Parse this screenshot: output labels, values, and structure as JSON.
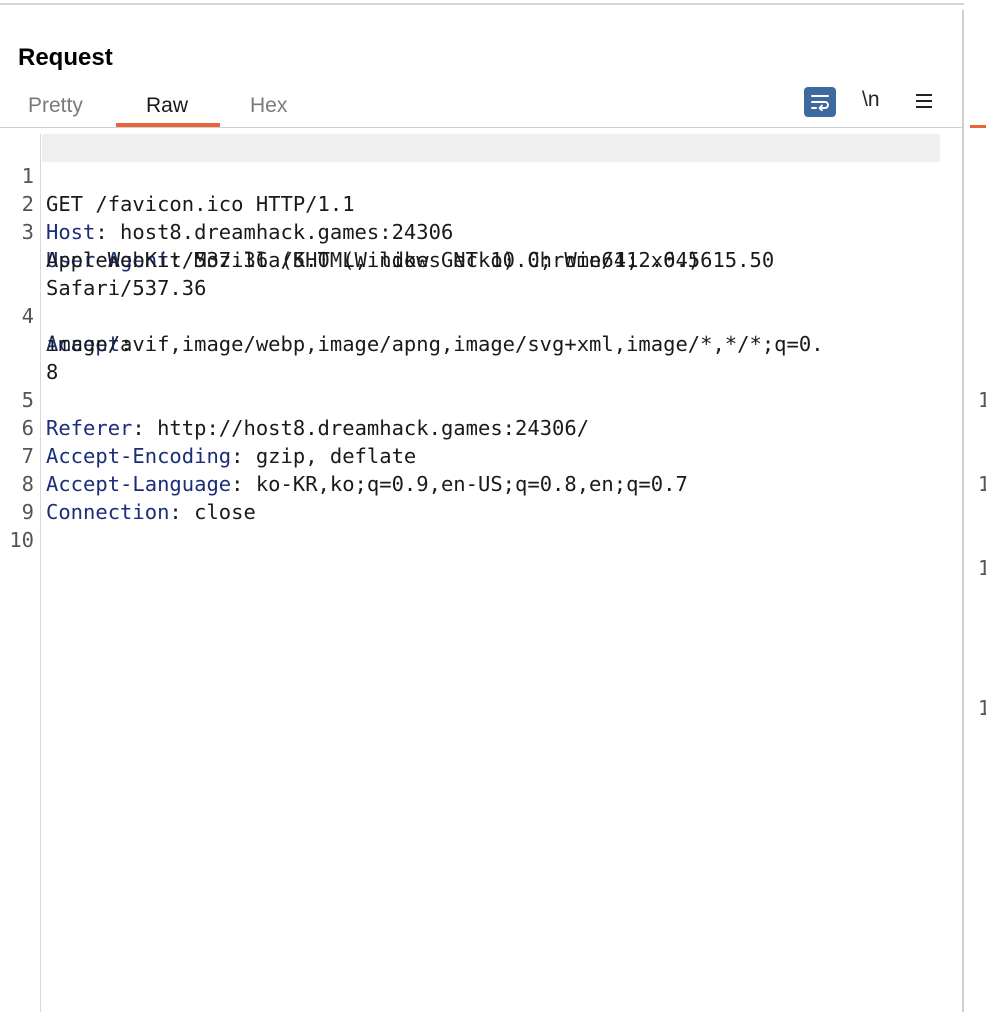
{
  "panel": {
    "title": "Request"
  },
  "tabs": [
    {
      "label": "Pretty",
      "active": false
    },
    {
      "label": "Raw",
      "active": true
    },
    {
      "label": "Hex",
      "active": false
    }
  ],
  "toolbar": {
    "wrap_icon": "wrap-lines-icon",
    "newline_label": "\\n",
    "menu_icon": "hamburger-menu-icon",
    "accent_color": "#e8643a",
    "wrap_button_color": "#3d6a9e"
  },
  "request": {
    "line1_num": "1",
    "line1_text": "GET /favicon.ico HTTP/1.1",
    "line2_num": "2",
    "line2_name": "Host",
    "line2_value": ": host8.dreamhack.games:24306",
    "line3_num": "3",
    "line3_name": "User-Agent",
    "line3_value": ": Mozilla/5.0 (Windows NT 10.0; Win64; x64)",
    "line3_cont1": "AppleWebKit/537.36 (KHTML, like Gecko) Chrome/112.0.5615.50",
    "line3_cont2": "Safari/537.36",
    "line4_num": "4",
    "line4_name": "Accept",
    "line4_value": ":",
    "line4_cont1": "image/avif,image/webp,image/apng,image/svg+xml,image/*,*/*;q=0.",
    "line4_cont2": "8",
    "line5_num": "5",
    "line5_name": "Referer",
    "line5_value": ": http://host8.dreamhack.games:24306/",
    "line6_num": "6",
    "line6_name": "Accept-Encoding",
    "line6_value": ": gzip, deflate",
    "line7_num": "7",
    "line7_name": "Accept-Language",
    "line7_value": ": ko-KR,ko;q=0.9,en-US;q=0.8,en;q=0.7",
    "line8_num": "8",
    "line8_name": "Connection",
    "line8_value": ": close",
    "line9_num": "9",
    "line10_num": "10"
  },
  "side_panel_numbers": [
    "1",
    "1",
    "1",
    "1"
  ]
}
